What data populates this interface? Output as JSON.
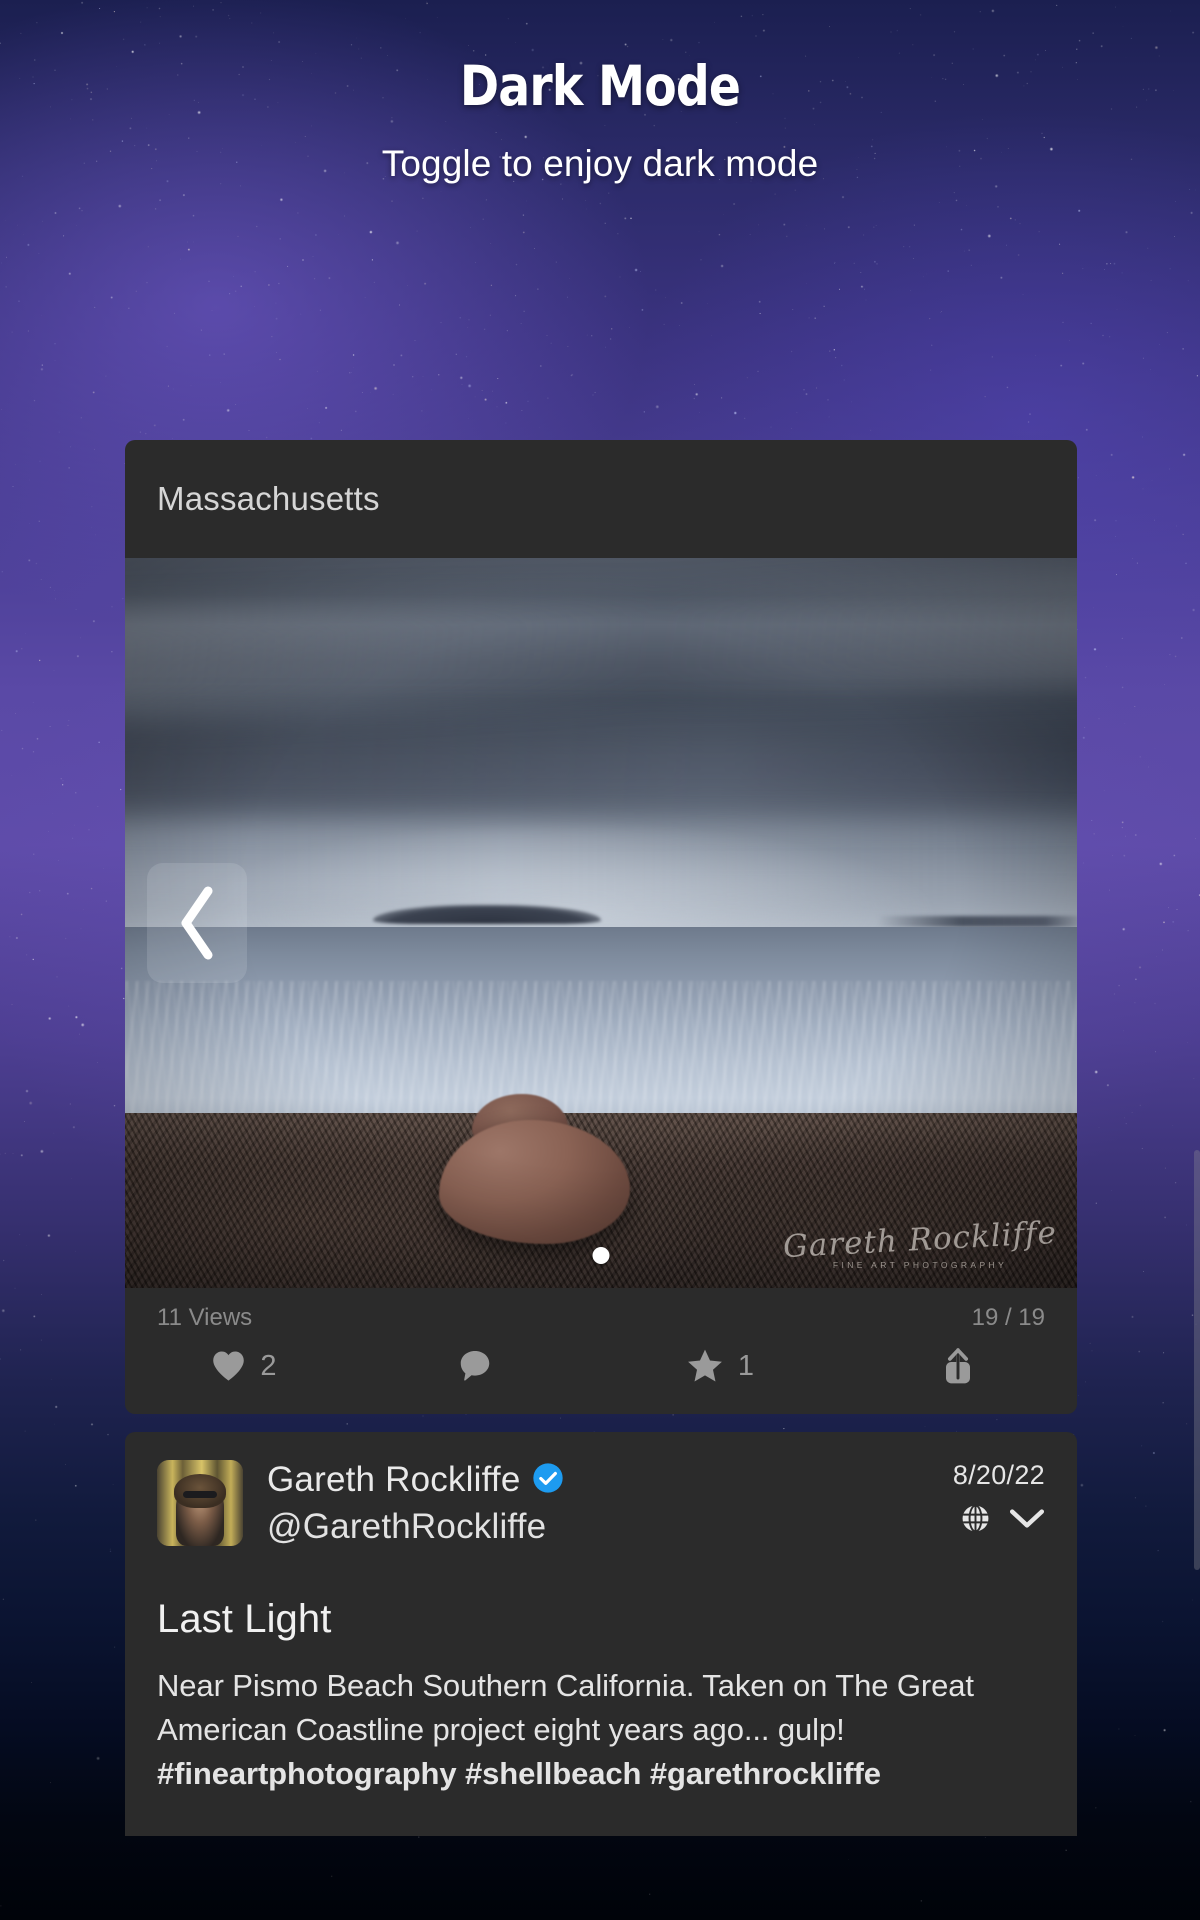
{
  "header": {
    "title": "Dark Mode",
    "subtitle": "Toggle to enjoy dark mode"
  },
  "card": {
    "location_title": "Massachusetts",
    "photo": {
      "alt": "Stormy seascape with distant wooded island and foreground rock",
      "watermark_signature": "Gareth Rockliffe",
      "watermark_subtitle": "FINE ART PHOTOGRAPHY",
      "prev_icon": "chevron-left-icon",
      "page_dot_count": 1,
      "current_dot": 1
    },
    "stats": {
      "views": "11 Views",
      "counter": "19 / 19",
      "like_icon": "heart-icon",
      "like_count": "2",
      "comment_icon": "comment-bubble-icon",
      "comment_count": "",
      "star_icon": "star-icon",
      "star_count": "1",
      "share_icon": "share-up-arrow-icon"
    }
  },
  "post": {
    "avatar_icon": "user-avatar",
    "display_name": "Gareth Rockliffe",
    "verified_icon": "verified-badge-icon",
    "handle": "@GarethRockliffe",
    "date": "8/20/22",
    "visibility_icon": "globe-icon",
    "expand_icon": "chevron-down-icon",
    "title": "Last Light",
    "body_plain": "Near Pismo Beach Southern California. Taken on The Great American Coastline project eight years ago... gulp! ",
    "body_tags": "#fineartphotography #shellbeach #garethrockliffe"
  },
  "colors": {
    "card_surface": "#2b2b2b",
    "primary_text": "#e9e9e9",
    "muted_text": "#8a8a8a",
    "icon_gray": "#9a9a9a",
    "verified_blue": "#1d9bf0",
    "background_top": "#3b3380",
    "background_bottom": "#000309"
  }
}
